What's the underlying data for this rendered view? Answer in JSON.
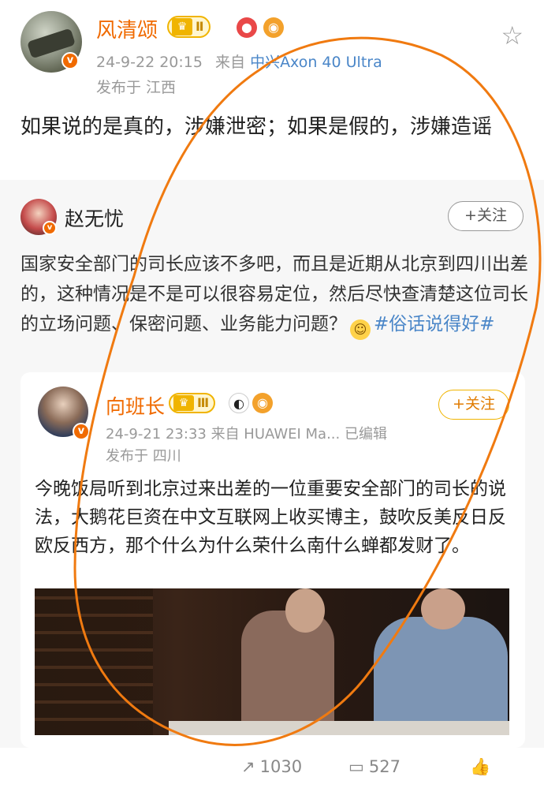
{
  "post": {
    "author": "风清颂",
    "level": "Ⅱ",
    "timestamp": "24-9-22 20:15",
    "source_prefix": "来自",
    "device": "中兴Axon 40 Ultra",
    "location": "发布于 江西",
    "text": "如果说的是真的，涉嫌泄密；如果是假的，涉嫌造谣"
  },
  "repost": {
    "author": "赵无忧",
    "follow_label": "+关注",
    "text_main": "国家安全部门的司长应该不多吧，而且是近期从北京到四川出差的，这种情况是不是可以很容易定位，然后尽快查清楚这位司长的立场问题、保密问题、业务能力问题？",
    "hashtag": "#俗话说得好#"
  },
  "original": {
    "author": "向班长",
    "level": "Ⅲ",
    "follow_label": "+关注",
    "meta": "24-9-21 23:33  来自 HUAWEI Ma...  已编辑",
    "location": "发布于 四川",
    "text": "今晚饭局听到北京过来出差的一位重要安全部门的司长的说法，大鹅花巨资在中文互联网上收买博主，鼓吹反美反日反欧反西方，那个什么为什么荣什么南什么蝉都发财了。"
  },
  "actions": {
    "forward_count": "1030",
    "comment_count": "527"
  },
  "icons": {
    "star": "star-icon",
    "forward": "forward-icon",
    "comment": "comment-icon",
    "like": "like-icon"
  },
  "colors": {
    "author": "#f06a00",
    "link": "#4a86c8",
    "annotation": "#f07a10"
  }
}
